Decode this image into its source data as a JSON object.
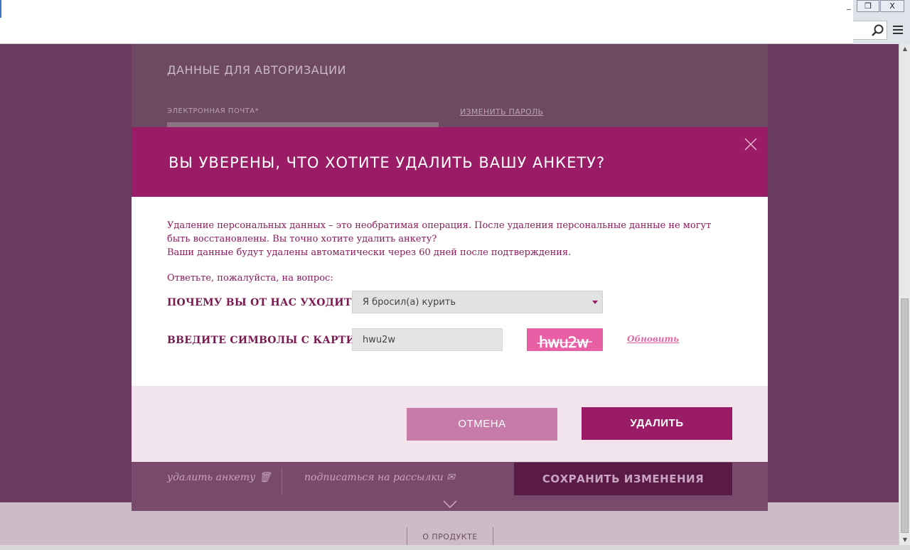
{
  "browser": {
    "window_buttons": [
      "_",
      "❐",
      "X"
    ]
  },
  "page": {
    "auth_heading": "ДАННЫЕ ДЛЯ АВТОРИЗАЦИИ",
    "email_label": "ЭЛЕКТРОННАЯ ПОЧТА*",
    "change_password": "ИЗМЕНИТЬ ПАРОЛЬ",
    "delete_profile": "удалить анкету",
    "subscribe": "подписаться на рассылки",
    "save_changes": "СОХРАНИТЬ ИЗМЕНЕНИЯ",
    "footer_link": "О ПРОДУКТЕ"
  },
  "modal": {
    "title": "ВЫ УВЕРЕНЫ, ЧТО ХОТИТЕ УДАЛИТЬ ВАШУ АНКЕТУ?",
    "text_line1": "Удаление персональных данных – это необратимая операция. После удаления персональные данные не могут быть восстановлены. Вы точно хотите удалить анкету?",
    "text_line2": "Ваши данные будут удалены автоматически через 60 дней после подтверждения.",
    "question_prompt": "Ответьте, пожалуйста, на вопрос:",
    "reason_label": "ПОЧЕМУ ВЫ ОТ НАС УХОДИТЕ?",
    "reason_value": "Я бросил(а) курить",
    "captcha_label": "ВВЕДИТЕ СИМВОЛЫ С КАРТИНКИ",
    "captcha_value": "hwu2w",
    "captcha_image_text": "hwu2w",
    "refresh": "Обновить",
    "cancel": "ОТМЕНА",
    "delete": "УДАЛИТЬ"
  },
  "colors": {
    "accent": "#9b1c66",
    "cancel": "#c77ba8",
    "captcha_bg": "#e85fa6"
  }
}
